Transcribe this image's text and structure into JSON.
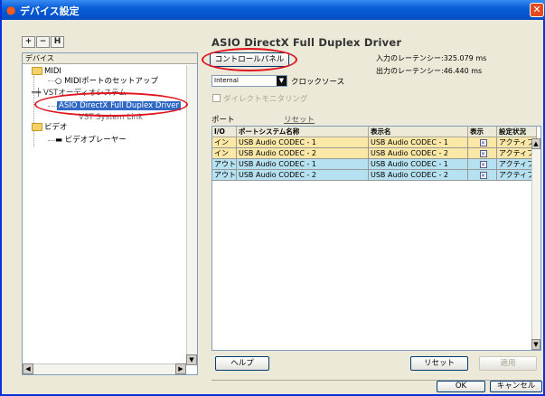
{
  "window": {
    "title": "デバイス設定",
    "close_glyph": "✕"
  },
  "toolbar": {
    "add": "+",
    "remove": "−",
    "reset": "H"
  },
  "tree": {
    "header": "デバイス",
    "midi": "MIDI",
    "midi_port_setup": "MIDIポートのセットアップ",
    "vst_partial": "VSTオーディオシステム",
    "asio_driver": "ASIO DirectX Full Duplex Driver",
    "vst_system_link": "VST System Link",
    "video": "ビデオ",
    "video_player": "ビデオプレーヤー"
  },
  "driver": {
    "title": "ASIO DirectX Full Duplex Driver",
    "control_panel": "コントロールパネル",
    "input_latency": "入力のレーテンシー:325.079 ms",
    "output_latency": "出力のレーテンシー:46.440 ms",
    "clock_value": "Internal",
    "clock_label": "クロックソース",
    "direct_monitoring": "ダイレクトモニタリング",
    "ports_label": "ポート",
    "reset_link": "リセット"
  },
  "table": {
    "headers": [
      "I/O",
      "ポートシステム名称",
      "表示名",
      "表示",
      "設定状況"
    ],
    "rows": [
      {
        "io": "イン",
        "system": "USB Audio CODEC  - 1",
        "display": "USB Audio CODEC  - 1",
        "show": "✕",
        "status": "アクティブ",
        "kind": "in"
      },
      {
        "io": "イン",
        "system": "USB Audio CODEC  - 2",
        "display": "USB Audio CODEC  - 2",
        "show": "✕",
        "status": "アクティブ",
        "kind": "in"
      },
      {
        "io": "アウト",
        "system": "USB Audio CODEC  - 1",
        "display": "USB Audio CODEC  - 1",
        "show": "✕",
        "status": "アクティブ",
        "kind": "out"
      },
      {
        "io": "アウト",
        "system": "USB Audio CODEC  - 2",
        "display": "USB Audio CODEC  - 2",
        "show": "✕",
        "status": "アクティブ",
        "kind": "out"
      }
    ]
  },
  "buttons": {
    "help": "ヘルプ",
    "reset": "リセット",
    "apply": "適用",
    "ok": "OK",
    "cancel": "キャンセル"
  },
  "colors": {
    "highlight_ring": "#e0141e",
    "input_row": "#fbe8a6",
    "output_row": "#b6e1f0",
    "titlebar": "#0a5fd6"
  }
}
